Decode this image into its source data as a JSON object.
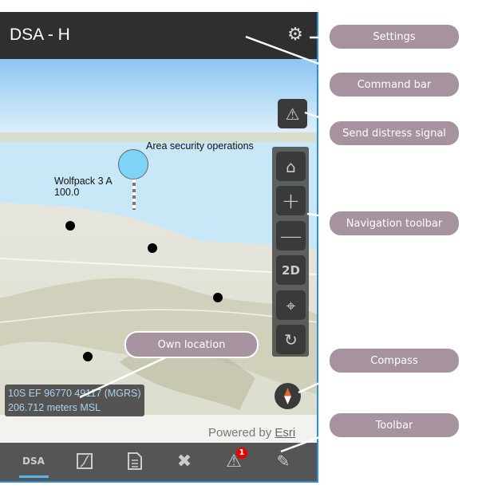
{
  "header": {
    "title": "DSA - H",
    "settings_icon": "gear-icon"
  },
  "map": {
    "labels": {
      "area": "Area security operations",
      "unit_name": "Wolfpack 3 A",
      "unit_value": "100.0"
    },
    "coords": {
      "mgrs": "10S EF 96770 49117 (MGRS)",
      "elevation": "206.712 meters MSL"
    },
    "attribution": {
      "prefix": "Powered by ",
      "link": "Esri"
    },
    "nav": {
      "home": "home-icon",
      "zoom_in": "plus-icon",
      "zoom_out": "minus-icon",
      "mode": "2D",
      "locate": "crosshair-icon",
      "rotate": "rotate-icon"
    }
  },
  "toolbar": {
    "dsa_label": "DSA",
    "alert_badge": "1",
    "active_color": "#5ab4ee"
  },
  "callouts": {
    "settings": "Settings",
    "command_bar": "Command bar",
    "distress": "Send distress signal",
    "navigation": "Navigation toolbar",
    "compass": "Compass",
    "toolbar": "Toolbar",
    "own_location": "Own location"
  },
  "colors": {
    "callout": "#a7929f",
    "header": "#2f2f2f",
    "toolbar": "#555555",
    "border": "#2a8fe0"
  }
}
